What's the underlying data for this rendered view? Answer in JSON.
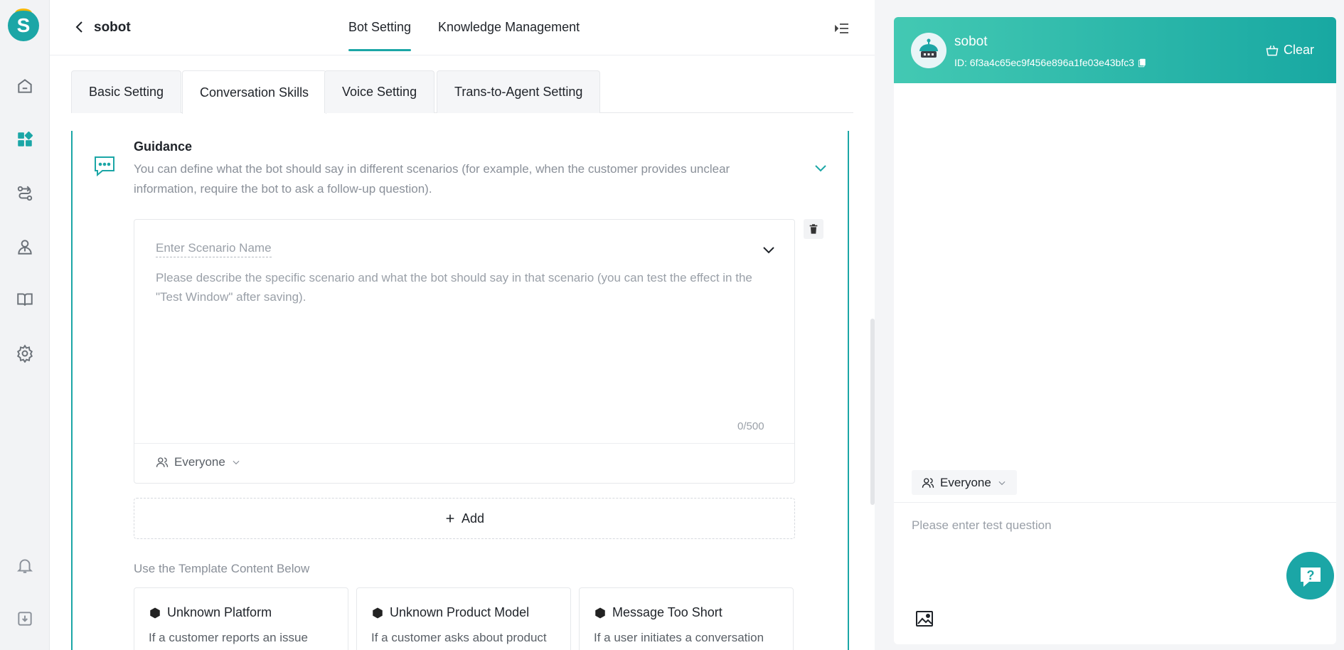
{
  "brand": {
    "accent": "#1ba6a6",
    "logo_letter": "S"
  },
  "header": {
    "app_name": "sobot",
    "tabs": [
      {
        "label": "Bot Setting",
        "active": true
      },
      {
        "label": "Knowledge Management",
        "active": false
      }
    ]
  },
  "subtabs": [
    {
      "label": "Basic Setting",
      "active": false
    },
    {
      "label": "Conversation Skills",
      "active": true
    },
    {
      "label": "Voice Setting",
      "active": false
    },
    {
      "label": "Trans-to-Agent Setting",
      "active": false
    }
  ],
  "guidance": {
    "title": "Guidance",
    "description": "You can define what the bot should say in different scenarios (for example, when the customer provides unclear information, require the bot to ask a follow-up question).",
    "scenario": {
      "name_placeholder": "Enter Scenario Name",
      "description_placeholder": "Please describe the specific scenario and what the bot should say in that scenario (you can test the effect in the \"Test Window\" after saving).",
      "counter": "0/500",
      "audience": "Everyone"
    },
    "add_label": "Add",
    "template_label": "Use the Template Content Below",
    "templates": [
      {
        "title": "Unknown Platform",
        "desc": "If a customer reports an issue"
      },
      {
        "title": "Unknown Product Model",
        "desc": "If a customer asks about product"
      },
      {
        "title": "Message Too Short",
        "desc": "If a user initiates a conversation"
      }
    ]
  },
  "test_window": {
    "bot_name": "sobot",
    "bot_id": "ID: 6f3a4c65ec9f456e896a1fe03e43bfc3",
    "clear_label": "Clear",
    "audience": "Everyone",
    "input_placeholder": "Please enter test question"
  },
  "icons": {
    "rail": [
      "home-icon",
      "apps-icon",
      "flow-icon",
      "agent-icon",
      "book-icon",
      "gear-icon",
      "bell-icon",
      "download-icon"
    ]
  }
}
